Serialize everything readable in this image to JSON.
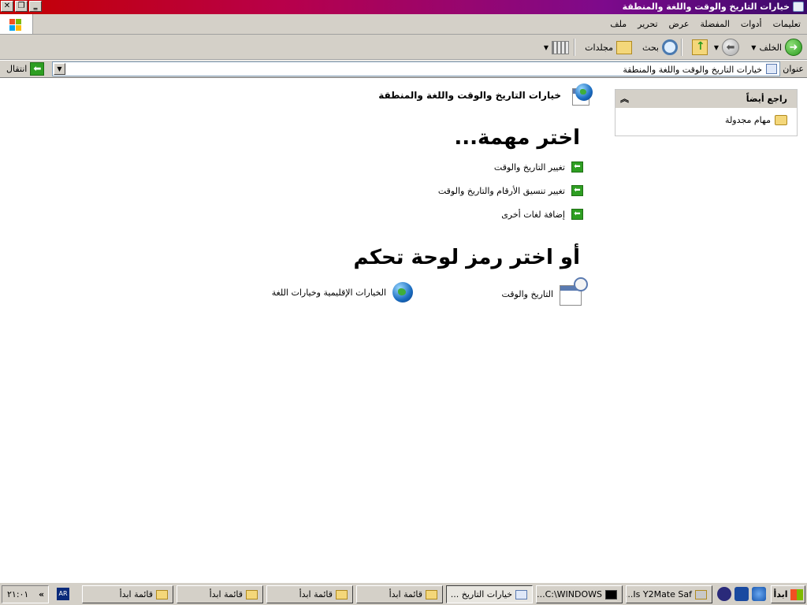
{
  "window": {
    "title": "خيارات التاريخ والوقت واللغة والمنطقة",
    "controls": {
      "close": "✕",
      "restore": "❐",
      "minimize": "‗"
    }
  },
  "menubar": {
    "items": [
      "ملف",
      "تحرير",
      "عرض",
      "المفضلة",
      "أدوات",
      "تعليمات"
    ]
  },
  "toolbar": {
    "back_label": "الخلف",
    "search_label": "بحث",
    "folders_label": "مجلدات"
  },
  "address": {
    "label": "عنوان",
    "value": "خيارات التاريخ والوقت واللغة والمنطقة",
    "go_label": "انتقال"
  },
  "side_panel": {
    "title": "راجع أيضاً",
    "items": [
      {
        "label": "مهام مجدولة"
      }
    ]
  },
  "main": {
    "category_title": "خيارات التاريخ والوقت واللغة والمنطقة",
    "pick_task_heading": "اختر مهمة...",
    "tasks": [
      {
        "label": "تغيير التاريخ والوقت"
      },
      {
        "label": "تغيير تنسيق الأرقام والتاريخ والوقت"
      },
      {
        "label": "إضافة لغات أخرى"
      }
    ],
    "pick_icon_heading": "أو اختر رمز لوحة تحكم",
    "icons": [
      {
        "label": "التاريخ والوقت",
        "icon": "date-time-icon"
      },
      {
        "label": "الخيارات الإقليمية وخيارات اللغة",
        "icon": "globe-icon"
      }
    ]
  },
  "taskbar": {
    "start_label": "ابدأ",
    "buttons": [
      {
        "label": "Is Y2Mate Saf..."
      },
      {
        "label": "C:\\WINDOWS...)"
      },
      {
        "label": "خيارات التاريخ ..."
      },
      {
        "label": "قائمة ابدأ"
      },
      {
        "label": "قائمة ابدأ"
      },
      {
        "label": "قائمة ابدأ"
      },
      {
        "label": "قائمة ابدأ"
      }
    ],
    "language": "AR",
    "clock": "٢١:٠١",
    "chevron": "«"
  }
}
